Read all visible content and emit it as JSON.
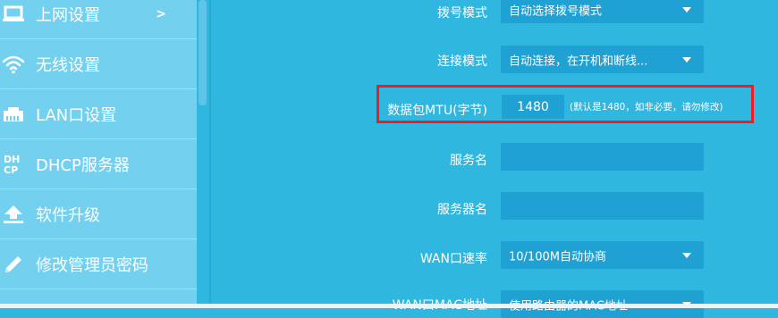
{
  "sidebar": {
    "items": [
      {
        "label": "上网设置",
        "icon": "laptop-icon",
        "arrow": ">"
      },
      {
        "label": "无线设置",
        "icon": "wifi-icon"
      },
      {
        "label": "LAN口设置",
        "icon": "ethernet-port-icon"
      },
      {
        "label": "DHCP服务器",
        "icon": "dhcp-icon",
        "icon_text": "DH\nCP"
      },
      {
        "label": "软件升级",
        "icon": "upload-icon"
      },
      {
        "label": "修改管理员密码",
        "icon": "pencil-icon"
      }
    ]
  },
  "form": {
    "dial_mode": {
      "label": "拨号模式",
      "value": "自动选择拨号模式"
    },
    "connect_mode": {
      "label": "连接模式",
      "value": "自动连接，在开机和断线..."
    },
    "mtu": {
      "label": "数据包MTU(字节)",
      "value": "1480",
      "hint": "(默认是1480，如非必要，请勿修改)"
    },
    "service_name": {
      "label": "服务名",
      "value": ""
    },
    "server_name": {
      "label": "服务器名",
      "value": ""
    },
    "wan_speed": {
      "label": "WAN口速率",
      "value": "10/100M自动协商"
    },
    "wan_mac": {
      "label": "WAN口MAC地址",
      "value": "使用路由器的MAC地址"
    }
  },
  "colors": {
    "background": "#2fb7e0",
    "sidebar": "#73d1ef",
    "field": "#1fa1d3",
    "highlight": "#ee1c24"
  }
}
